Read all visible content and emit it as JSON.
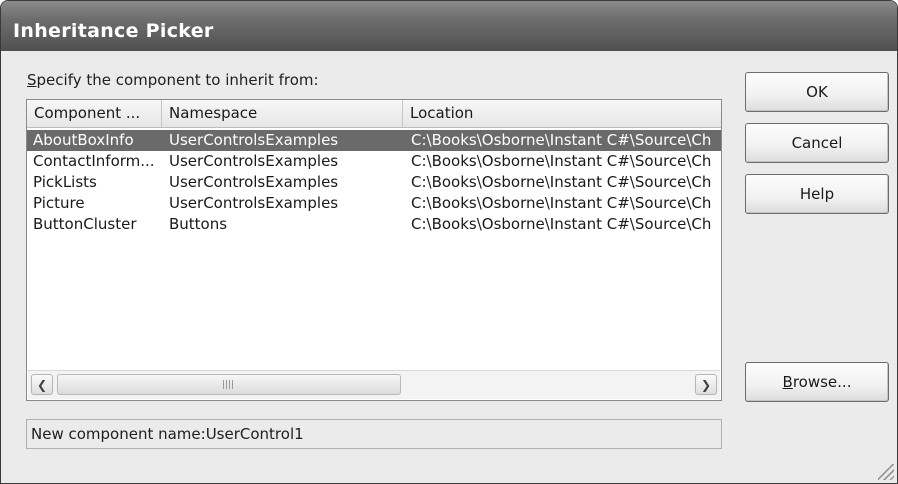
{
  "dialog": {
    "title": "Inheritance Picker",
    "prompt_mnemonic": "S",
    "prompt_rest": "pecify the component to inherit from:"
  },
  "list": {
    "columns": [
      "Component ...",
      "Namespace",
      "Location"
    ],
    "rows": [
      {
        "component": "AboutBoxInfo",
        "namespace": "UserControlsExamples",
        "location": "C:\\Books\\Osborne\\Instant C#\\Source\\Ch",
        "selected": true
      },
      {
        "component": "ContactInform...",
        "namespace": "UserControlsExamples",
        "location": "C:\\Books\\Osborne\\Instant C#\\Source\\Ch",
        "selected": false
      },
      {
        "component": "PickLists",
        "namespace": "UserControlsExamples",
        "location": "C:\\Books\\Osborne\\Instant C#\\Source\\Ch",
        "selected": false
      },
      {
        "component": "Picture",
        "namespace": "UserControlsExamples",
        "location": "C:\\Books\\Osborne\\Instant C#\\Source\\Ch",
        "selected": false
      },
      {
        "component": "ButtonCluster",
        "namespace": "Buttons",
        "location": "C:\\Books\\Osborne\\Instant C#\\Source\\Ch",
        "selected": false
      }
    ]
  },
  "name_field": {
    "value": "New component name:UserControl1"
  },
  "buttons": {
    "ok": "OK",
    "cancel": "Cancel",
    "help": "Help",
    "browse_mnemonic": "B",
    "browse_rest": "rowse..."
  },
  "icons": {
    "scroll_left": "scroll-left-icon",
    "scroll_right": "scroll-right-icon",
    "resize_grip": "resize-grip-icon"
  },
  "colors": {
    "selection": "#6a6a6a",
    "titlebar": "#5a5a5a"
  }
}
